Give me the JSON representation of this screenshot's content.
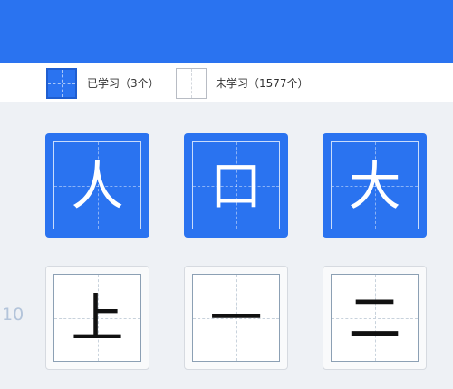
{
  "legend": {
    "learned_label": "已学习（3个）",
    "unlearned_label": "未学习（1577个）"
  },
  "row_number": "10",
  "characters": [
    {
      "char": "人",
      "status": "learned"
    },
    {
      "char": "口",
      "status": "learned"
    },
    {
      "char": "大",
      "status": "learned"
    },
    {
      "char": "上",
      "status": "unlearned"
    },
    {
      "char": "一",
      "status": "unlearned"
    },
    {
      "char": "二",
      "status": "unlearned"
    }
  ],
  "colors": {
    "accent": "#2a73f0",
    "background": "#eef1f5"
  }
}
